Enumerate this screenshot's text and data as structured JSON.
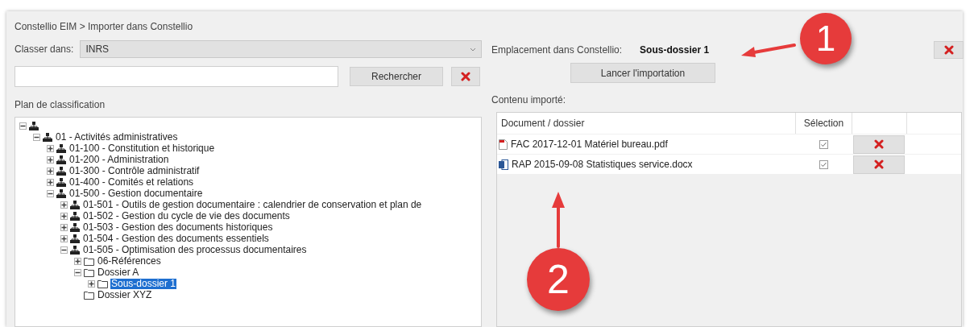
{
  "breadcrumb": "Constellio EIM > Importer dans Constellio",
  "left": {
    "classer_label": "Classer dans:",
    "classer_value": "INRS",
    "search_button": "Rechercher",
    "tree_label": "Plan de classification",
    "tree": [
      {
        "kind": "category",
        "expandable": true,
        "expanded": true,
        "children": [
          {
            "label": "01 - Activités administratives",
            "kind": "category",
            "expandable": true,
            "expanded": true,
            "selected": false,
            "children": [
              {
                "label": "01-100 - Constitution et historique",
                "kind": "category",
                "expandable": true,
                "expanded": false,
                "selected": false
              },
              {
                "label": "01-200 - Administration",
                "kind": "category",
                "expandable": true,
                "expanded": false,
                "selected": false
              },
              {
                "label": "01-300 - Contrôle administratif",
                "kind": "category",
                "expandable": true,
                "expanded": false,
                "selected": false
              },
              {
                "label": "01-400 - Comités et relations",
                "kind": "category",
                "expandable": true,
                "expanded": false,
                "selected": false
              },
              {
                "label": "01-500 - Gestion documentaire",
                "kind": "category",
                "expandable": true,
                "expanded": true,
                "selected": false,
                "children": [
                  {
                    "label": "01-501 - Outils de gestion documentaire : calendrier de conservation et plan de",
                    "kind": "category",
                    "expandable": true,
                    "expanded": false,
                    "selected": false
                  },
                  {
                    "label": "01-502 - Gestion du cycle de vie des documents",
                    "kind": "category",
                    "expandable": true,
                    "expanded": false,
                    "selected": false
                  },
                  {
                    "label": "01-503 - Gestion des documents historiques",
                    "kind": "category",
                    "expandable": true,
                    "expanded": false,
                    "selected": false
                  },
                  {
                    "label": "01-504 - Gestion des documents essentiels",
                    "kind": "category",
                    "expandable": true,
                    "expanded": false,
                    "selected": false
                  },
                  {
                    "label": "01-505 - Optimisation des processus documentaires",
                    "kind": "category",
                    "expandable": true,
                    "expanded": true,
                    "selected": false,
                    "children": [
                      {
                        "label": "06-Références",
                        "kind": "folder",
                        "expandable": true,
                        "expanded": false,
                        "selected": false
                      },
                      {
                        "label": "Dossier A",
                        "kind": "folder",
                        "expandable": true,
                        "expanded": true,
                        "selected": false,
                        "children": [
                          {
                            "label": "Sous-dossier 1",
                            "kind": "folder",
                            "expandable": true,
                            "expanded": false,
                            "selected": true
                          }
                        ]
                      },
                      {
                        "label": "Dossier XYZ",
                        "kind": "folder",
                        "expandable": false,
                        "selected": false
                      }
                    ]
                  }
                ]
              }
            ]
          }
        ]
      }
    ]
  },
  "right": {
    "location_label": "Emplacement dans Constellio:",
    "location_value": "Sous-dossier 1",
    "import_button": "Lancer l'importation",
    "content_label": "Contenu importé:",
    "table": {
      "columns": [
        "Document / dossier",
        "Sélection"
      ],
      "rows": [
        {
          "kind": "pdf",
          "name": "FAC 2017-12-01 Matériel bureau.pdf",
          "checked": true
        },
        {
          "kind": "docx",
          "name": "RAP 2015-09-08 Statistiques service.docx",
          "checked": true
        }
      ]
    }
  },
  "callouts": [
    {
      "text": "1"
    },
    {
      "text": "2"
    }
  ]
}
